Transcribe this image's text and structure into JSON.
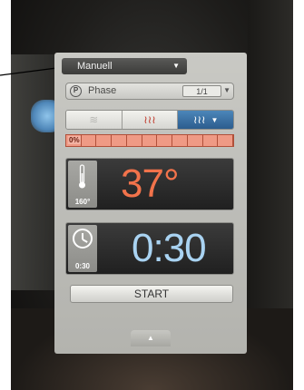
{
  "header": {
    "program_label": "Manuell"
  },
  "phase": {
    "label": "Phase",
    "count": "1/1"
  },
  "modes": [
    {
      "name": "steam",
      "glyph": "≋",
      "active": false
    },
    {
      "name": "combi",
      "glyph": "≀≀≀",
      "active": false
    },
    {
      "name": "hot-air",
      "glyph": "≀≀≀",
      "active": true
    }
  ],
  "progress": {
    "percent_label": "0%",
    "value": 0
  },
  "temperature": {
    "value": "37°",
    "setpoint": "160°"
  },
  "timer": {
    "value": "0:30",
    "setpoint": "0:30"
  },
  "actions": {
    "start_label": "START"
  },
  "colors": {
    "accent": "#3d73a6",
    "temperature": "#f2734b",
    "time": "#a9d3f2",
    "progress": "#ef9a85"
  }
}
